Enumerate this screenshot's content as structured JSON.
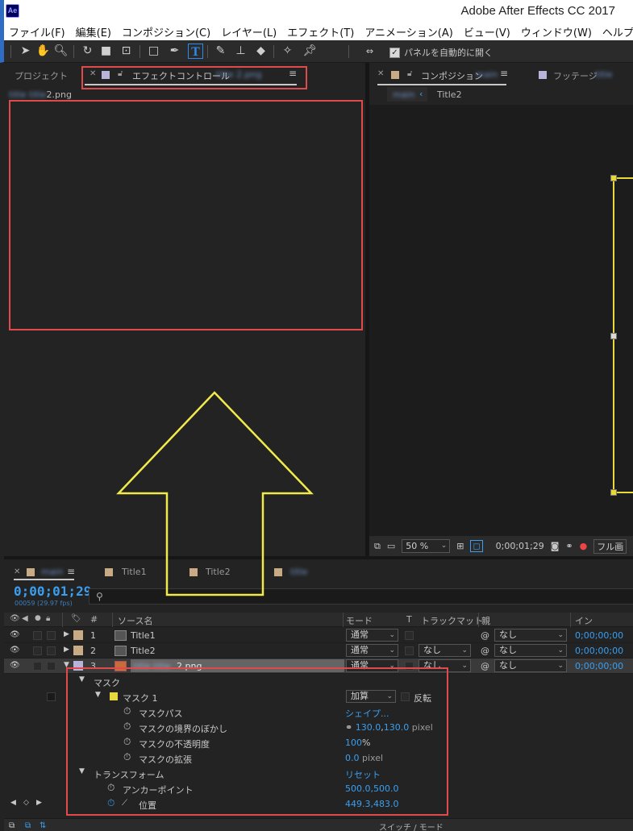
{
  "window": {
    "app_icon": "Ae",
    "title": "Adobe After Effects CC 2017"
  },
  "menu": [
    "ファイル(F)",
    "編集(E)",
    "コンポジション(C)",
    "レイヤー(L)",
    "エフェクト(T)",
    "アニメーション(A)",
    "ビュー(V)",
    "ウィンドウ(W)",
    "ヘルプ(H)"
  ],
  "toolbar": {
    "auto_open_label": "パネルを自動的に開く",
    "auto_open_checked": "✓"
  },
  "left_panel": {
    "project_tab": "プロジェクト",
    "effect_tab_label": "エフェクトコントロール",
    "effect_tab_blurred": "title 2.png",
    "sub_name_blurred": "title title",
    "sub_name_suffix": "2.png"
  },
  "right_panel": {
    "comp_tab": "コンポジション",
    "comp_tab_blurred": "main",
    "footage_tab": "フッテージ",
    "footage_tab_blurred": "title",
    "breadcrumb_blurred": "main",
    "breadcrumb_item": "Title2",
    "zoom": "50 %",
    "timecode": "0;00;01;29",
    "resolution": "フル画"
  },
  "timeline": {
    "tabs": {
      "main_blurred": "main",
      "title1": "Title1",
      "title2": "Title2",
      "other_blurred": "title"
    },
    "timecode": "0;00;01;29",
    "frames": "00059 (29.97 fps)",
    "headers": {
      "num": "#",
      "source": "ソース名",
      "mode": "モード",
      "t": "T",
      "trackmatte": "トラックマット",
      "parent": "親",
      "in": "イン"
    },
    "layers": [
      {
        "num": "1",
        "name": "Title1",
        "mode": "通常",
        "matte": "",
        "parent": "なし",
        "in": "0;00;00;00",
        "color": "#c8ab84"
      },
      {
        "num": "2",
        "name": "Title2",
        "mode": "通常",
        "matte": "なし",
        "parent": "なし",
        "in": "0;00;00;00",
        "color": "#c8ab84"
      },
      {
        "num": "3",
        "name_blurred": "title title",
        "name_suffix": "2.png",
        "mode": "通常",
        "matte": "なし",
        "parent": "なし",
        "in": "0;00;00;00",
        "color": "#b7b3d9"
      }
    ],
    "props": {
      "mask_group": "マスク",
      "mask1": "マスク 1",
      "mask_mode": "加算",
      "invert": "反転",
      "mask_path": "マスクパス",
      "mask_path_val": "シェイプ...",
      "feather": "マスクの境界のぼかし",
      "feather_x": "130.0",
      "feather_y": "130.0",
      "pixel": "pixel",
      "opacity": "マスクの不透明度",
      "opacity_val": "100",
      "percent": "%",
      "expansion": "マスクの拡張",
      "expansion_val": "0.0",
      "transform": "トランスフォーム",
      "reset": "リセット",
      "anchor": "アンカーポイント",
      "anchor_val": "500.0,500.0",
      "position": "位置",
      "position_val": "449.3,483.0",
      "comma": ","
    },
    "bottom_label": "スイッチ / モード"
  },
  "colors": {
    "accent_blue": "#3a9ff0",
    "highlight_red": "#e04a4a",
    "arrow_yellow": "#f1ea4b",
    "layer_yellow": "#e8d93a"
  }
}
